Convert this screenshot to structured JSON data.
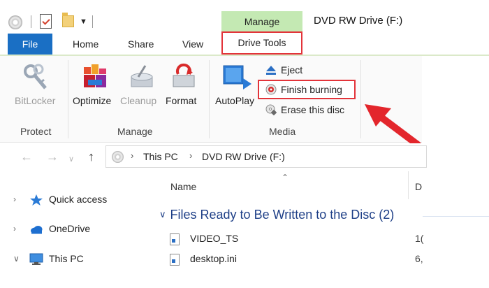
{
  "window": {
    "context_tab_group": "Manage",
    "title": "DVD RW Drive (F:)"
  },
  "tabs": {
    "file": "File",
    "home": "Home",
    "share": "Share",
    "view": "View",
    "drive_tools": "Drive Tools"
  },
  "ribbon": {
    "groups": {
      "protect": "Protect",
      "manage": "Manage",
      "media": "Media"
    },
    "buttons": {
      "bitlocker": "BitLocker",
      "optimize": "Optimize",
      "cleanup": "Cleanup",
      "format": "Format",
      "autoplay": "AutoPlay",
      "eject": "Eject",
      "finish_burning": "Finish burning",
      "erase_disc": "Erase this disc"
    }
  },
  "address_bar": {
    "crumbs": [
      "This PC",
      "DVD RW Drive (F:)"
    ]
  },
  "nav_pane": {
    "items": [
      {
        "label": "Quick access",
        "icon": "star-icon"
      },
      {
        "label": "OneDrive",
        "icon": "cloud-icon"
      },
      {
        "label": "This PC",
        "icon": "monitor-icon"
      }
    ]
  },
  "content": {
    "columns": {
      "name": "Name",
      "date": "D"
    },
    "group": "Files Ready to Be Written to the Disc (2)",
    "files": [
      {
        "name": "VIDEO_TS",
        "date": "1("
      },
      {
        "name": "desktop.ini",
        "date": "6,"
      }
    ]
  },
  "colors": {
    "file_tab": "#1a6fc4",
    "manage_context": "#c4e9b3",
    "highlight_box": "#e3343a",
    "group_header_text": "#1e3f87"
  }
}
